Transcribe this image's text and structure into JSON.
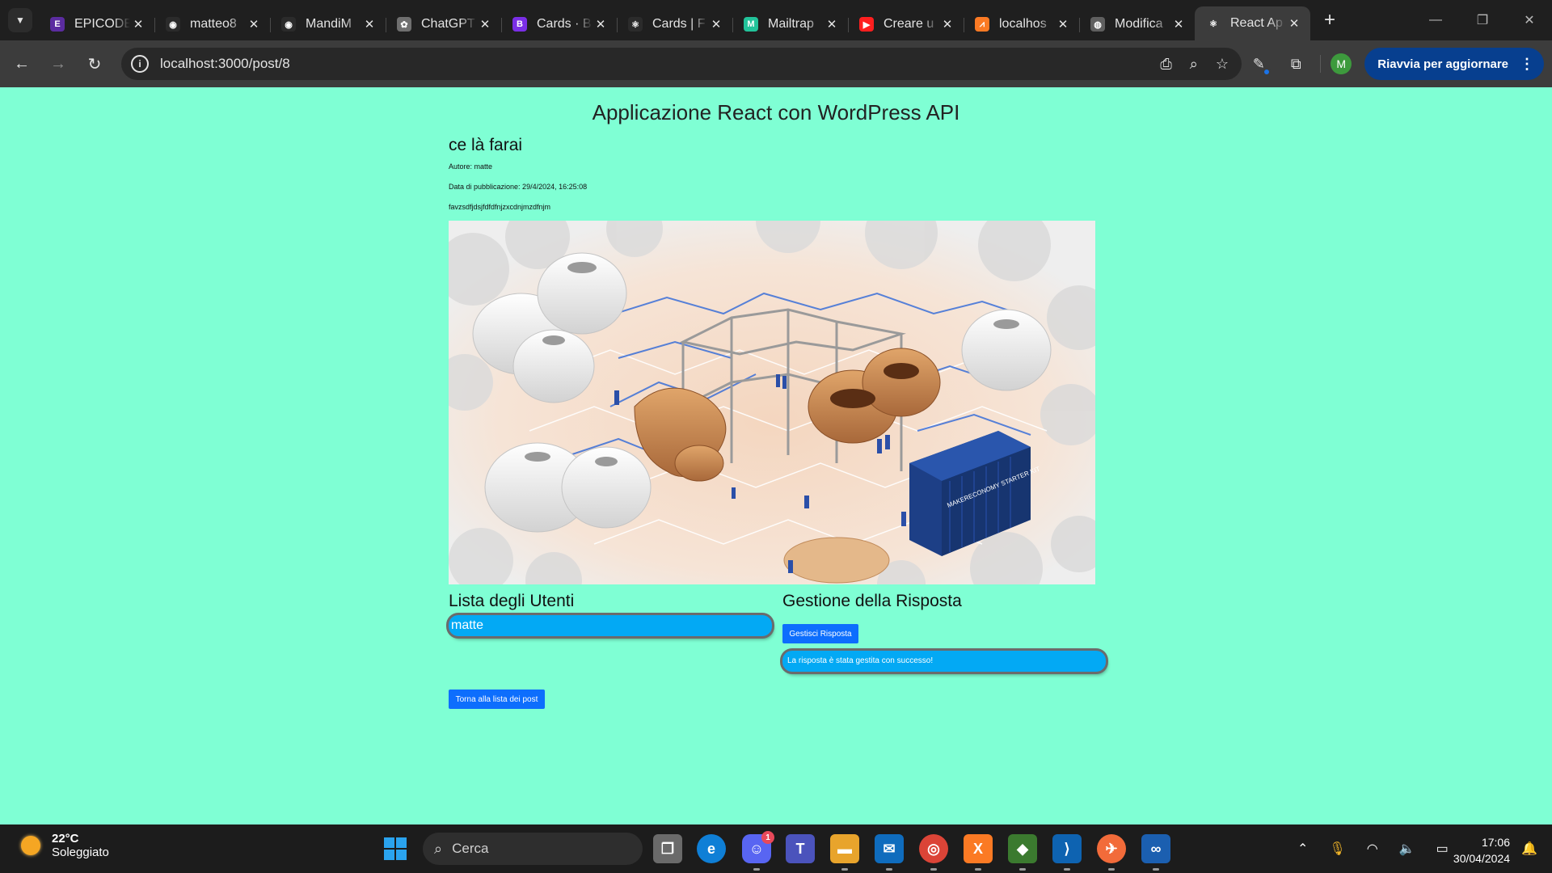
{
  "browser": {
    "tabs": [
      {
        "title": "EPICODE",
        "favicon": "epicode-icon",
        "color": "#5b2ca0",
        "glyph": "E"
      },
      {
        "title": "matteo8",
        "favicon": "github-icon",
        "color": "#2b2b2b",
        "glyph": "◉"
      },
      {
        "title": "MandiM",
        "favicon": "github-icon",
        "color": "#2b2b2b",
        "glyph": "◉"
      },
      {
        "title": "ChatGPT",
        "favicon": "chatgpt-icon",
        "color": "#6f6f6f",
        "glyph": "✿"
      },
      {
        "title": "Cards · B",
        "favicon": "bootstrap-icon",
        "color": "#7a2ee6",
        "glyph": "B"
      },
      {
        "title": "Cards | F",
        "favicon": "react-icon",
        "color": "#2b2b2b",
        "glyph": "⚛"
      },
      {
        "title": "Mailtrap",
        "favicon": "mailtrap-icon",
        "color": "#22c39a",
        "glyph": "M"
      },
      {
        "title": "Creare u",
        "favicon": "youtube-icon",
        "color": "#ff1f1f",
        "glyph": "▶"
      },
      {
        "title": "localhos",
        "favicon": "xampp-icon",
        "color": "#fb7a24",
        "glyph": "⩘"
      },
      {
        "title": "Modifica",
        "favicon": "globe-icon",
        "color": "#5f5f5f",
        "glyph": "◍"
      },
      {
        "title": "React Ap",
        "favicon": "react-icon",
        "color": "#3c3c3c",
        "glyph": "⚛",
        "active": true
      }
    ],
    "url": "localhost:3000/post/8",
    "update_label": "Riavvia per aggiornare",
    "profile_initial": "M"
  },
  "page": {
    "app_title": "Applicazione React con WordPress API",
    "post": {
      "title": "ce là farai",
      "author": "Autore: matte",
      "date": "Data di pubblicazione: 29/4/2024, 16:25:08",
      "content": "favzsdfjdsjfdfdfnjzxcdnjmzdfnjm",
      "image_alt": "container-label-makereconomy-starter-kit"
    },
    "users_heading": "Lista degli Utenti",
    "users": [
      "matte"
    ],
    "response_heading": "Gestione della Risposta",
    "manage_button": "Gestisci Risposta",
    "success_message": "La risposta è stata gestita con successo!",
    "back_button": "Torna alla lista dei post",
    "container_text": "MAKERECONOMY STARTER KIT"
  },
  "taskbar": {
    "weather_temp": "22°C",
    "weather_desc": "Soleggiato",
    "search_placeholder": "Cerca",
    "time": "17:06",
    "date": "30/04/2024",
    "discord_badge": "1"
  }
}
